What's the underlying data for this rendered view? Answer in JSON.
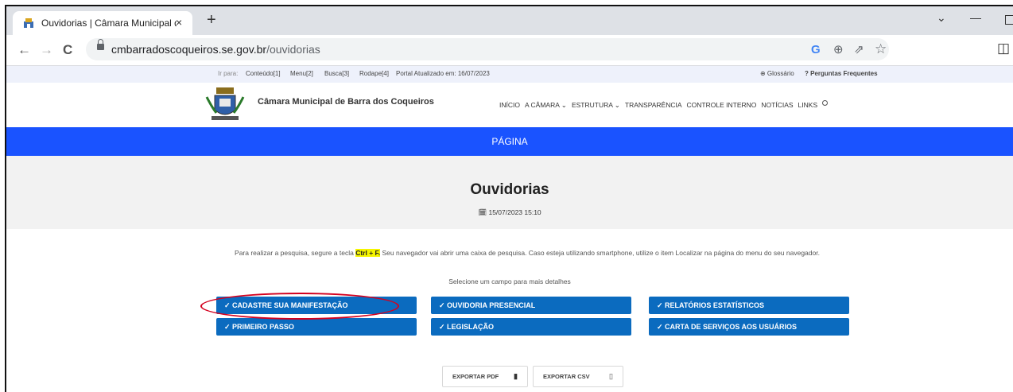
{
  "browser": {
    "tab_title": "Ouvidorias | Câmara Municipal de Barra dos Coqueiros",
    "tab_close": "×",
    "new_tab": "+",
    "url_domain": "cmbarradoscoqueiros.se.gov.br",
    "url_path": "/ouvidorias",
    "back": "←",
    "forward": "→",
    "reload": "C",
    "google": "G",
    "zoom": "⊕",
    "share": "⇗",
    "star": "☆",
    "sidepanel": "◫",
    "minimize": "—",
    "chevron": "⌄"
  },
  "topbar": {
    "ir_para": "Ir para:",
    "conteudo": "Conteúdo[1]",
    "menu": "Menu[2]",
    "busca": "Busca[3]",
    "rodape": "Rodape[4]",
    "atualizado": "Portal Atualizado em: 16/07/2023",
    "glossario": "⊕ Glossário",
    "perguntas": "? Perguntas Frequentes"
  },
  "header": {
    "site_title": "Câmara Municipal de Barra dos Coqueiros",
    "menu": [
      "INÍCIO",
      "A CÂMARA ⌄",
      "ESTRUTURA ⌄",
      "TRANSPARÊNCIA",
      "CONTROLE INTERNO",
      "NOTÍCIAS",
      "LINKS"
    ]
  },
  "bluebar": {
    "label": "PÁGINA"
  },
  "page": {
    "title": "Ouvidorias",
    "date": "🗓 15/07/2023 15:10",
    "info_before": "Para realizar a pesquisa, segure a tecla ",
    "info_key": "Ctrl + F.",
    "info_after": " Seu navegador vai abrir uma caixa de pesquisa. Caso esteja utilizando smartphone, utilize o item Localizar na página do menu do seu navegador.",
    "select": "Selecione um campo para mais detalhes"
  },
  "buttons": {
    "cadastre": "✓ CADASTRE SUA MANIFESTAÇÃO",
    "presencial": "✓ OUVIDORIA PRESENCIAL",
    "relatorios": "✓ RELATÓRIOS ESTATÍSTICOS",
    "primeiro": "✓ PRIMEIRO PASSO",
    "legislacao": "✓ LEGISLAÇÃO",
    "carta": "✓ CARTA DE SERVIÇOS AOS USUÁRIOS"
  },
  "export": {
    "pdf": "EXPORTAR PDF",
    "csv": "EXPORTAR CSV"
  },
  "colors": {
    "blue_bar": "#1a53ff",
    "button": "#0b6bbf",
    "highlight_oval": "#d4001e"
  }
}
